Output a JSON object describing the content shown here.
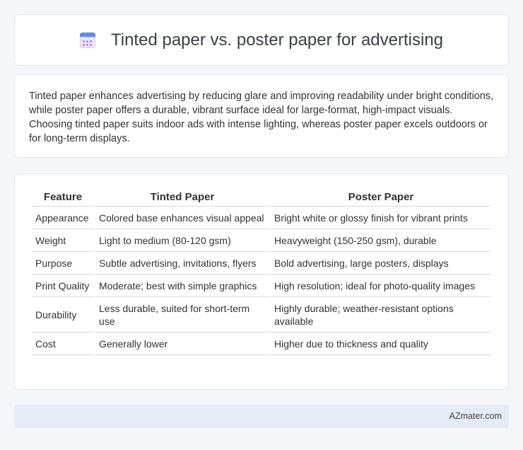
{
  "header": {
    "title": "Tinted paper vs. poster paper for advertising",
    "icon": "calendar-icon"
  },
  "intro": {
    "text": "Tinted paper enhances advertising by reducing glare and improving readability under bright conditions, while poster paper offers a durable, vibrant surface ideal for large-format, high-impact visuals. Choosing tinted paper suits indoor ads with intense lighting, whereas poster paper excels outdoors or for long-term displays."
  },
  "table": {
    "columns": [
      "Feature",
      "Tinted Paper",
      "Poster Paper"
    ],
    "rows": [
      [
        "Appearance",
        "Colored base enhances visual appeal",
        "Bright white or glossy finish for vibrant prints"
      ],
      [
        "Weight",
        "Light to medium (80-120 gsm)",
        "Heavyweight (150-250 gsm), durable"
      ],
      [
        "Purpose",
        "Subtle advertising, invitations, flyers",
        "Bold advertising, large posters, displays"
      ],
      [
        "Print Quality",
        "Moderate; best with simple graphics",
        "High resolution; ideal for photo-quality images"
      ],
      [
        "Durability",
        "Less durable, suited for short-term use",
        "Highly durable; weather-resistant options available"
      ],
      [
        "Cost",
        "Generally lower",
        "Higher due to thickness and quality"
      ]
    ]
  },
  "footer": {
    "brand": "AZmater.com"
  }
}
